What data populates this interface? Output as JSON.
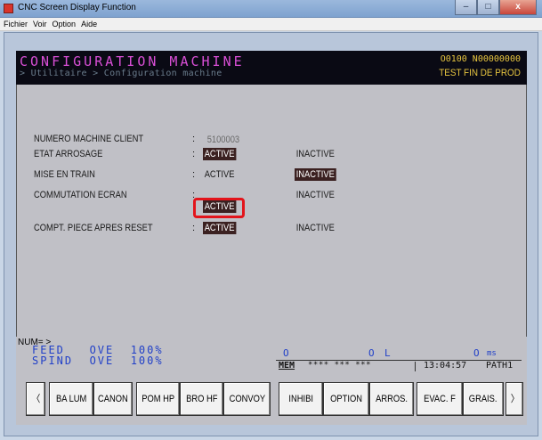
{
  "window": {
    "title": "CNC Screen Display Function",
    "controls": [
      "–",
      "□",
      "x"
    ]
  },
  "menu": [
    "Fichier",
    "Voir",
    "Option",
    "Aide"
  ],
  "header": {
    "title": "CONFIGURATION  MACHINE",
    "breadcrumb": "> Utilitaire > Configuration machine",
    "program_code": "O0100 N00000000",
    "mode": "TEST FIN DE PROD"
  },
  "settings": [
    {
      "label": "NUMERO MACHINE CLIENT",
      "colon": ":",
      "value": "5100003"
    },
    {
      "label": "ETAT ARROSAGE",
      "colon": ":",
      "option_a": "ACTIVE",
      "option_b": "INACTIVE",
      "selected": "a"
    },
    {
      "label": "MISE EN TRAIN",
      "colon": ": ",
      "option_a": "ACTIVE",
      "option_b": "INACTIVE",
      "selected": "b"
    },
    {
      "label": "COMMUTATION ECRAN",
      "colon": ":",
      "option_a": "ACTIVE",
      "option_b": "INACTIVE",
      "selected": "a"
    },
    {
      "label": "COMPT. PIECE APRES RESET",
      "colon": ":",
      "option_a": "ACTIVE",
      "option_b": "INACTIVE",
      "selected": "a"
    }
  ],
  "status": {
    "num_prompt": "NUM= >",
    "feed_line": "FEED   OVE  100%",
    "spind_line": "SPIND  OVE  100%",
    "o_left": "O",
    "o_mid": "O",
    "l_label": "L",
    "o_right": "O",
    "ms": "ms",
    "mem": "MEM",
    "stars": "**** *** ***",
    "clock": "13:04:57",
    "path": "PATH1"
  },
  "softkeys": [
    "〈",
    "BA LUM",
    "CANON",
    "POM HP",
    "BRO HF",
    "CONVOY",
    "INHIBI",
    "OPTION",
    "ARROS.",
    "EVAC. F",
    "GRAIS.",
    "〉"
  ],
  "colors": {
    "title_magenta": "#d94fd6",
    "header_yellow": "#e8c640",
    "status_blue": "#2140c8",
    "selected_bg": "#3b2121",
    "highlight_red": "#e3141b"
  }
}
